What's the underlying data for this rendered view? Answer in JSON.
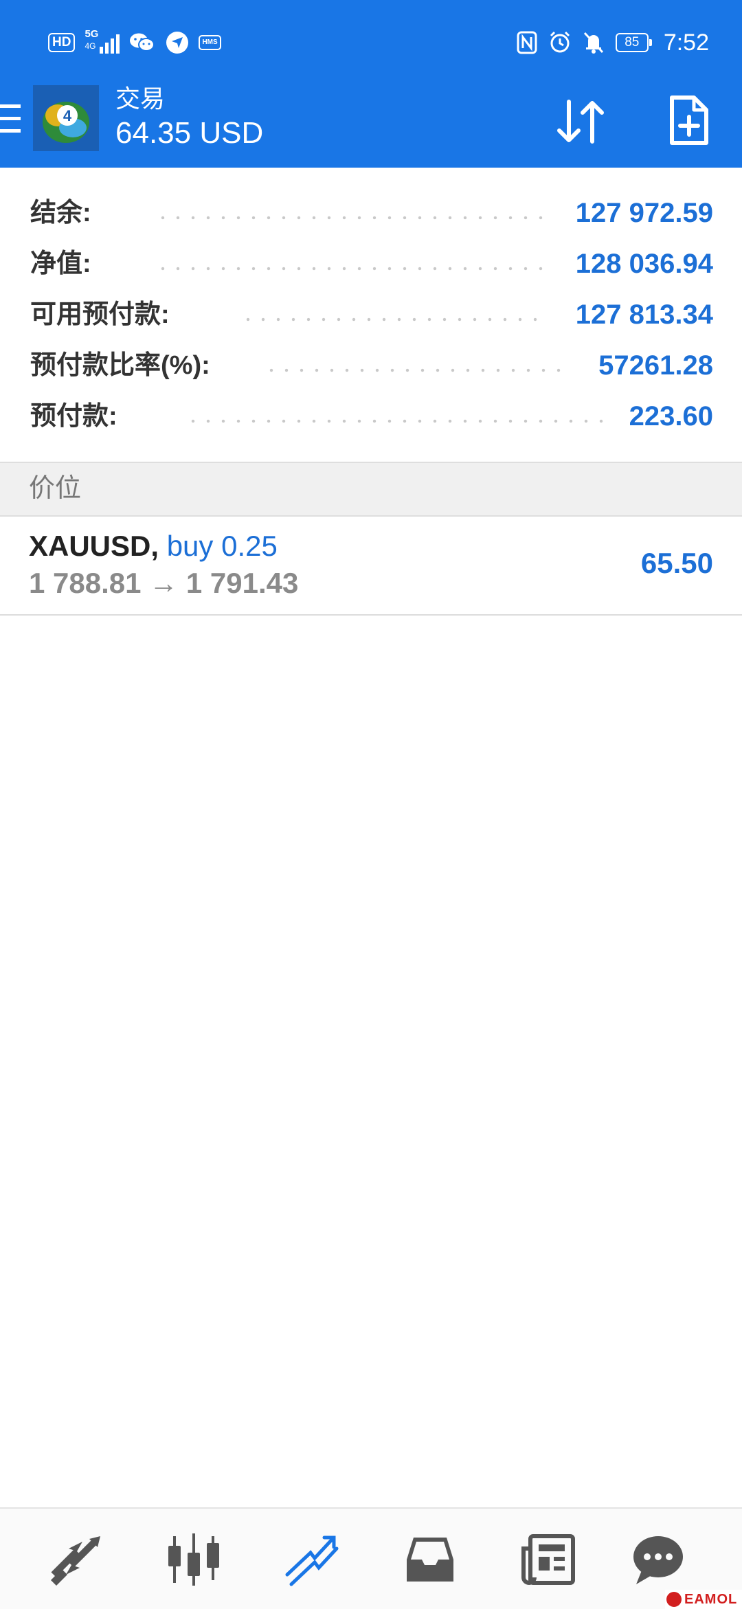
{
  "status_bar": {
    "hd_label": "HD",
    "network": "5G",
    "network_sub": "4G",
    "hms_label": "HMS",
    "battery": "85",
    "time": "7:52",
    "icons": [
      "wechat-icon",
      "location-icon",
      "nfc-icon",
      "alarm-icon",
      "mute-icon"
    ]
  },
  "app_bar": {
    "title": "交易",
    "subtitle": "64.35 USD",
    "icons": [
      "menu-icon",
      "mt4-logo",
      "sort-arrows-icon",
      "new-document-icon"
    ]
  },
  "account": {
    "balance": {
      "label": "结余:",
      "value": "127 972.59"
    },
    "equity": {
      "label": "净值:",
      "value": "128 036.94"
    },
    "free_margin": {
      "label": "可用预付款:",
      "value": "127 813.34"
    },
    "margin_level": {
      "label": "预付款比率(%):",
      "value": "57261.28"
    },
    "margin": {
      "label": "预付款:",
      "value": "223.60"
    }
  },
  "positions_section": {
    "title": "价位"
  },
  "positions": [
    {
      "symbol": "XAUUSD,",
      "side": "buy 0.25",
      "open_price": "1 788.81",
      "arrow": "→",
      "current_price": "1 791.43",
      "profit": "65.50"
    }
  ],
  "bottom_nav": {
    "items": [
      "quotes-icon",
      "charts-icon",
      "trade-icon",
      "history-icon",
      "news-icon",
      "chat-icon"
    ],
    "active_item": "trade-icon",
    "active_color": "#1976e6",
    "inactive_color": "#555555"
  },
  "watermark": {
    "text": "EAMOL"
  },
  "colors": {
    "app_bar": "#1976e6",
    "value_text": "#1c6fd6",
    "label_text": "#333333"
  }
}
